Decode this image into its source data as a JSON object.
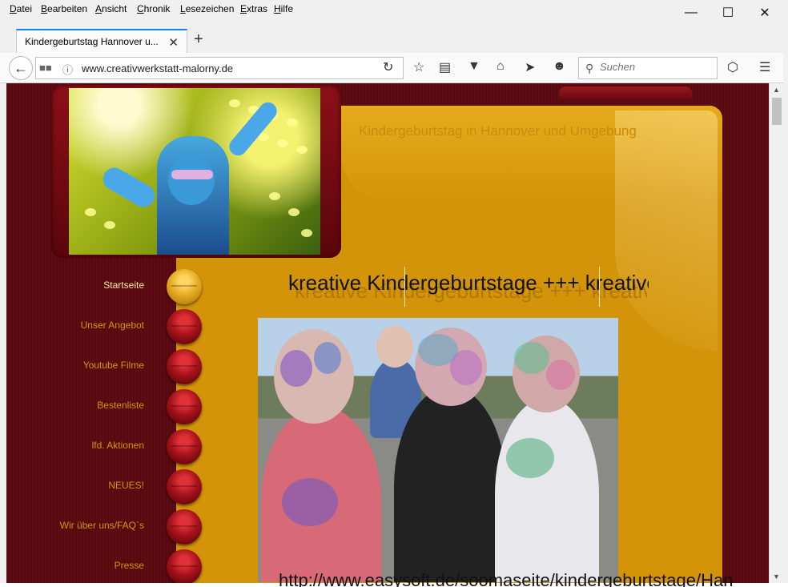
{
  "menubar": {
    "items": [
      "Datei",
      "Bearbeiten",
      "Ansicht",
      "Chronik",
      "Lesezeichen",
      "Extras",
      "Hilfe"
    ]
  },
  "window": {
    "minimize": "—",
    "maximize": "☐",
    "close": "✕"
  },
  "tab": {
    "title": "Kindergeburtstag Hannover u...",
    "close": "✕",
    "new_tab": "+"
  },
  "navbar": {
    "url": "www.creativwerkstatt-malorny.de",
    "search_placeholder": "Suchen",
    "icons": [
      "back-arrow-icon",
      "library-icon",
      "info-icon",
      "reload-icon",
      "bookmark-star-icon",
      "reader-view-icon",
      "pocket-icon",
      "home-icon",
      "send-icon",
      "emoji-icon",
      "search-icon",
      "extension-icon",
      "hamburger-menu-icon"
    ]
  },
  "site": {
    "title": "Kindergeburtstag in Hannover und Umgebung",
    "ticker": "kreative Kindergeburtstage +++ kreative Kindergeburtstage +++",
    "nav": [
      {
        "label": "Startseite",
        "active": true
      },
      {
        "label": "Unser Angebot",
        "active": false
      },
      {
        "label": "Youtube Filme",
        "active": false
      },
      {
        "label": "Bestenliste",
        "active": false
      },
      {
        "label": "lfd. Aktionen",
        "active": false
      },
      {
        "label": "NEUES!",
        "active": false
      },
      {
        "label": "Wir über uns/FAQ`s",
        "active": false
      },
      {
        "label": "Presse",
        "active": false
      }
    ]
  },
  "background_window": {
    "url_fragment": "http://www.easysoft.de/soomaseite/kindergeburtstage/Han"
  },
  "colors": {
    "page_bg": "#5e0c12",
    "panel_gold": "#d4940a",
    "nav_text": "#d4940a",
    "tab_accent": "#0a84ff"
  }
}
